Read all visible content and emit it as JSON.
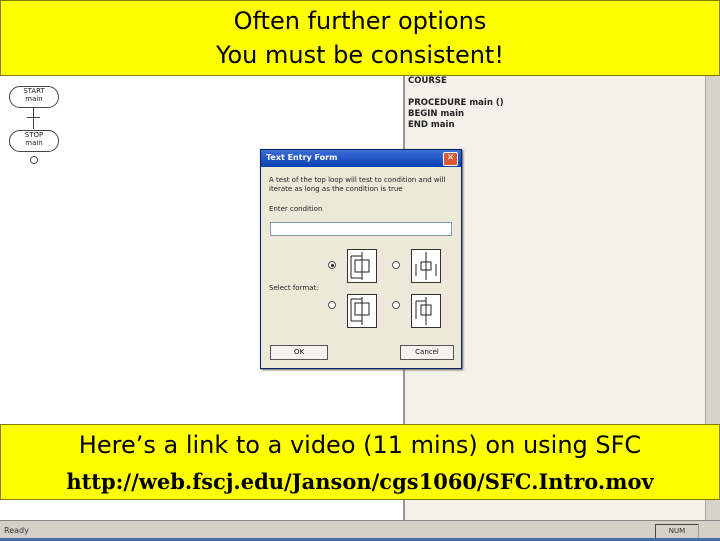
{
  "banner_top": {
    "line1": "Often further options",
    "line2": "You must be consistent!"
  },
  "banner_bottom": {
    "line1": "Here’s a link to a video (11 mins) on using SFC",
    "line2": "http://web.fscj.edu/Janson/cgs1060/SFC.Intro.mov"
  },
  "diagram": {
    "start_label": "START",
    "start_sub": "main",
    "stop_label": "STOP",
    "stop_sub": "main"
  },
  "code_pane": {
    "lines": [
      "COURSE",
      "PROCEDURE main ()",
      "BEGIN main",
      "END main"
    ]
  },
  "dialog": {
    "title": "Text Entry Form",
    "close_glyph": "✕",
    "description": "A test of the top loop will test to condition and will iterate as long as the condition is true",
    "enter_label": "Enter condition",
    "input_value": "",
    "select_label": "Select format:",
    "ok_label": "OK",
    "cancel_label": "Cancel",
    "options": [
      {
        "selected": true
      },
      {
        "selected": false
      },
      {
        "selected": false
      },
      {
        "selected": false
      }
    ]
  },
  "status_bar": {
    "left_text": "Ready",
    "right_text": "NUM"
  },
  "colors": {
    "banner": "#ffff00",
    "titlebar": "#0a3fb2",
    "close": "#d85a3a"
  }
}
